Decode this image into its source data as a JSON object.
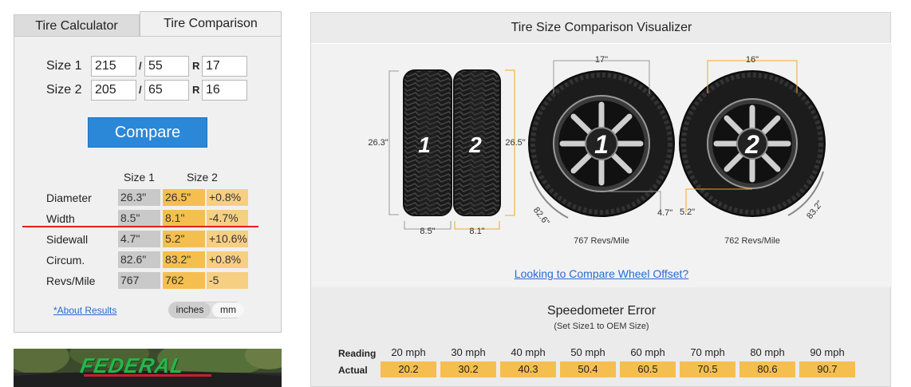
{
  "tabs": {
    "calculator": "Tire Calculator",
    "comparison": "Tire Comparison"
  },
  "sizes": [
    {
      "label": "Size 1",
      "width": "215",
      "sep1": "/",
      "aspect": "55",
      "sep2": "R",
      "rim": "17"
    },
    {
      "label": "Size 2",
      "width": "205",
      "sep1": "/",
      "aspect": "65",
      "sep2": "R",
      "rim": "16"
    }
  ],
  "compare_label": "Compare",
  "results": {
    "col1": "Size 1",
    "col2": "Size 2",
    "rows": [
      {
        "label": "Diameter",
        "s1": "26.3\"",
        "s2": "26.5\"",
        "diff": "+0.8%"
      },
      {
        "label": "Width",
        "s1": "8.5\"",
        "s2": "8.1\"",
        "diff": "-4.7%"
      },
      {
        "label": "Sidewall",
        "s1": "4.7\"",
        "s2": "5.2\"",
        "diff": "+10.6%"
      },
      {
        "label": "Circum.",
        "s1": "82.6\"",
        "s2": "83.2\"",
        "diff": "+0.8%"
      },
      {
        "label": "Revs/Mile",
        "s1": "767",
        "s2": "762",
        "diff": "-5"
      }
    ]
  },
  "about_link": "*About Results",
  "units": {
    "inches": "inches",
    "mm": "mm",
    "selected": "inches"
  },
  "ad": {
    "brand": "FEDERAL"
  },
  "visualizer": {
    "title": "Tire Size Comparison Visualizer",
    "tire1_num": "1",
    "tire2_num": "2",
    "tire1_height": "26.3\"",
    "tire2_height": "26.5\"",
    "tire1_width": "8.5\"",
    "tire2_width": "8.1\"",
    "wheel1_rim": "17\"",
    "wheel2_rim": "16\"",
    "wheel1_sidewall": "4.7\"",
    "wheel2_sidewall": "5.2\"",
    "wheel1_circ": "82.6\"",
    "wheel2_circ": "83.2\"",
    "wheel1_revs": "767 Revs/Mile",
    "wheel2_revs": "762 Revs/Mile",
    "offset_link": "Looking to Compare Wheel Offset?"
  },
  "speedometer": {
    "title": "Speedometer Error",
    "subtitle": "(Set Size1 to OEM Size)",
    "reading_label": "Reading",
    "actual_label": "Actual",
    "readings": [
      "20 mph",
      "30 mph",
      "40 mph",
      "50 mph",
      "60 mph",
      "70 mph",
      "80 mph",
      "90 mph"
    ],
    "actuals": [
      "20.2",
      "30.2",
      "40.3",
      "50.4",
      "60.5",
      "70.5",
      "80.6",
      "90.7"
    ]
  }
}
